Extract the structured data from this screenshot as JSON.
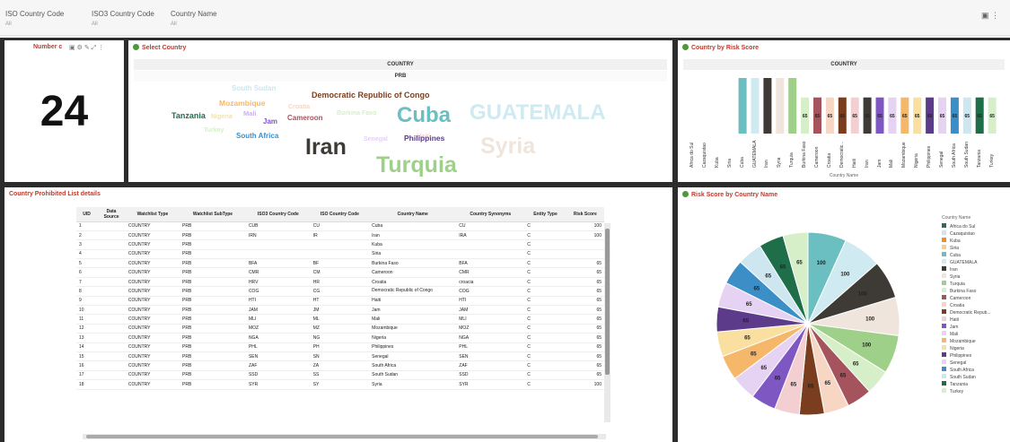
{
  "filters": [
    {
      "label": "ISO Country Code",
      "value": "All"
    },
    {
      "label": "ISO3 Country Code",
      "value": "All"
    },
    {
      "label": "Country Name",
      "value": "All"
    }
  ],
  "kpi": {
    "title": "Number c",
    "value": "24"
  },
  "wordcloud": {
    "title": "Select Country",
    "header1": "COUNTRY",
    "header2": "PRB",
    "words": [
      {
        "text": "South Sudan",
        "color": "#cde6f0"
      },
      {
        "text": "Democratic Republic of Congo",
        "color": "#7a3e1e"
      },
      {
        "text": "Mozambique",
        "color": "#f5b76a"
      },
      {
        "text": "Croatia",
        "color": "#f7d6c4"
      },
      {
        "text": "Tanzania",
        "color": "#1f6e4a"
      },
      {
        "text": "Nigeria",
        "color": "#f9dfa0"
      },
      {
        "text": "Mali",
        "color": "#c9b3e8"
      },
      {
        "text": "Jam",
        "color": "#7e57c2"
      },
      {
        "text": "Cameroon",
        "color": "#a5535d"
      },
      {
        "text": "Burkina Faso",
        "color": "#d6efc8"
      },
      {
        "text": "Cuba",
        "color": "#6bbfc0"
      },
      {
        "text": "GUATEMALA",
        "color": "#cfeaf0"
      },
      {
        "text": "Turkey",
        "color": "#d6efc8"
      },
      {
        "text": "South Africa",
        "color": "#3b8ec6"
      },
      {
        "text": "Haiti",
        "color": "#f3cfd2"
      },
      {
        "text": "Iran",
        "color": "#3e3a36"
      },
      {
        "text": "Senegal",
        "color": "#e6d2f2"
      },
      {
        "text": "Philippines",
        "color": "#5c3c8a"
      },
      {
        "text": "Syria",
        "color": "#efe5dc"
      },
      {
        "text": "Turquia",
        "color": "#9fd08a"
      }
    ]
  },
  "barchart": {
    "title": "Country by Risk Score",
    "header": "COUNTRY",
    "xlabel": "Country Name"
  },
  "table": {
    "title": "Country Prohibited List details",
    "columns": [
      "UID",
      "Data Source",
      "Watchlist Type",
      "Watchlist SubType",
      "ISO3 Country Code",
      "ISO Country Code",
      "Country Name",
      "Country Synonyms",
      "Entity Type",
      "Risk Score"
    ],
    "rows": [
      [
        "1",
        "",
        "COUNTRY",
        "PRB",
        "CUB",
        "CU",
        "Cuba",
        "CU",
        "C",
        "100"
      ],
      [
        "2",
        "",
        "COUNTRY",
        "PRB",
        "IRN",
        "IR",
        "Iran",
        "IRA",
        "C",
        "100"
      ],
      [
        "3",
        "",
        "COUNTRY",
        "PRB",
        "",
        "",
        "Kuba",
        "",
        "C",
        ""
      ],
      [
        "4",
        "",
        "COUNTRY",
        "PRB",
        "",
        "",
        "Siria",
        "",
        "C",
        ""
      ],
      [
        "5",
        "",
        "COUNTRY",
        "PRB",
        "BFA",
        "BF",
        "Burkina Faso",
        "BFA",
        "C",
        "65"
      ],
      [
        "6",
        "",
        "COUNTRY",
        "PRB",
        "CMR",
        "CM",
        "Cameroon",
        "CMR",
        "C",
        "65"
      ],
      [
        "7",
        "",
        "COUNTRY",
        "PRB",
        "HRV",
        "HR",
        "Croatia",
        "croacia",
        "C",
        "65"
      ],
      [
        "8",
        "",
        "COUNTRY",
        "PRB",
        "COG",
        "CG",
        "Democratic Republic of Congo",
        "COG",
        "C",
        "65"
      ],
      [
        "9",
        "",
        "COUNTRY",
        "PRB",
        "HTI",
        "HT",
        "Haiti",
        "HTI",
        "C",
        "65"
      ],
      [
        "10",
        "",
        "COUNTRY",
        "PRB",
        "JAM",
        "JM",
        "Jam",
        "JAM",
        "C",
        "65"
      ],
      [
        "11",
        "",
        "COUNTRY",
        "PRB",
        "MLI",
        "ML",
        "Mali",
        "MLI",
        "C",
        "65"
      ],
      [
        "12",
        "",
        "COUNTRY",
        "PRB",
        "MOZ",
        "MZ",
        "Mozambique",
        "MOZ",
        "C",
        "65"
      ],
      [
        "13",
        "",
        "COUNTRY",
        "PRB",
        "NGA",
        "NG",
        "Nigeria",
        "NGA",
        "C",
        "65"
      ],
      [
        "14",
        "",
        "COUNTRY",
        "PRB",
        "PHL",
        "PH",
        "Philippines",
        "PHL",
        "C",
        "65"
      ],
      [
        "15",
        "",
        "COUNTRY",
        "PRB",
        "SEN",
        "SN",
        "Senegal",
        "SEN",
        "C",
        "65"
      ],
      [
        "16",
        "",
        "COUNTRY",
        "PRB",
        "ZAF",
        "ZA",
        "South Africa",
        "ZAF",
        "C",
        "65"
      ],
      [
        "17",
        "",
        "COUNTRY",
        "PRB",
        "SSD",
        "SS",
        "South Sudan",
        "SSD",
        "C",
        "65"
      ],
      [
        "18",
        "",
        "COUNTRY",
        "PRB",
        "SYR",
        "SY",
        "Syria",
        "SYR",
        "C",
        "100"
      ]
    ]
  },
  "pie_title": "Risk Score by Country Name",
  "pie_legend_title": "Country Name",
  "chart_data": [
    {
      "type": "bar",
      "categories": [
        "Africa do Sul",
        "Cazaquistao",
        "Kuba",
        "Siria",
        "Cuba",
        "GUATEMALA",
        "Iran",
        "Syria",
        "Turquia",
        "Burkina Faso",
        "Cameroon",
        "Croatia",
        "Democratic...",
        "Haiti",
        "Iran",
        "Jam",
        "Mali",
        "Mozambique",
        "Nigeria",
        "Philippines",
        "Senegal",
        "South Africa",
        "South Sudan",
        "Tanzania",
        "Turkey"
      ],
      "values": [
        null,
        null,
        null,
        null,
        100,
        100,
        100,
        100,
        100,
        65,
        65,
        65,
        65,
        65,
        65,
        65,
        65,
        65,
        65,
        65,
        65,
        65,
        65,
        65,
        65
      ],
      "data_labels": [
        "",
        "",
        "",
        "",
        "",
        "",
        "",
        "",
        "",
        "65",
        "65",
        "65",
        "65",
        "65",
        "65",
        "65",
        "65",
        "65",
        "65",
        "65",
        "65",
        "65",
        "65",
        "65",
        "65"
      ],
      "colors": [
        "#2e6b5e",
        "#cde6f0",
        "#f28c28",
        "#f6d37a",
        "#6bbfc0",
        "#cfeaf0",
        "#3e3a36",
        "#efe5dc",
        "#9fd08a",
        "#d6efc8",
        "#a5535d",
        "#f7d6c4",
        "#7a3e1e",
        "#f3cfd2",
        "#3e3a36",
        "#7e57c2",
        "#e6d2f2",
        "#f5b76a",
        "#f9dfa0",
        "#5c3c8a",
        "#e6d2f2",
        "#3b8ec6",
        "#cde6f0",
        "#1f6e4a",
        "#d6efc8"
      ],
      "xlabel": "Country Name",
      "ylim": [
        0,
        100
      ]
    },
    {
      "type": "pie",
      "categories": [
        "Cuba",
        "GUATEMALA",
        "Iran",
        "Syria",
        "Turquia",
        "Burkina Faso",
        "Cameroon",
        "Croatia",
        "Democratic Repub...",
        "Haiti",
        "Jam",
        "Mali",
        "Mozambique",
        "Nigeria",
        "Philippines",
        "Senegal",
        "South Africa",
        "South Sudan",
        "Tanzania",
        "Turkey"
      ],
      "values": [
        100,
        100,
        100,
        100,
        100,
        65,
        65,
        65,
        65,
        65,
        65,
        65,
        65,
        65,
        65,
        65,
        65,
        65,
        65,
        65
      ],
      "colors": [
        "#6bbfc0",
        "#cfeaf0",
        "#3e3a36",
        "#efe5dc",
        "#9fd08a",
        "#d6efc8",
        "#a5535d",
        "#f7d6c4",
        "#7a3e1e",
        "#f3cfd2",
        "#7e57c2",
        "#e6d2f2",
        "#f5b76a",
        "#f9dfa0",
        "#5c3c8a",
        "#e6d2f2",
        "#3b8ec6",
        "#cde6f0",
        "#1f6e4a",
        "#d6efc8"
      ],
      "legend": [
        {
          "label": "Africa do Sul",
          "color": "#2e6b5e"
        },
        {
          "label": "Cazaquistao",
          "color": "#cde6f0"
        },
        {
          "label": "Kuba",
          "color": "#f28c28"
        },
        {
          "label": "Siria",
          "color": "#f6d37a"
        },
        {
          "label": "Cuba",
          "color": "#6bbfc0"
        },
        {
          "label": "GUATEMALA",
          "color": "#cfeaf0"
        },
        {
          "label": "Iran",
          "color": "#3e3a36"
        },
        {
          "label": "Syria",
          "color": "#efe5dc"
        },
        {
          "label": "Turquia",
          "color": "#9fd08a"
        },
        {
          "label": "Burkina Faso",
          "color": "#d6efc8"
        },
        {
          "label": "Cameroon",
          "color": "#a5535d"
        },
        {
          "label": "Croatia",
          "color": "#f7d6c4"
        },
        {
          "label": "Democratic Repub...",
          "color": "#7a3e1e"
        },
        {
          "label": "Haiti",
          "color": "#f3cfd2"
        },
        {
          "label": "Jam",
          "color": "#7e57c2"
        },
        {
          "label": "Mali",
          "color": "#e6d2f2"
        },
        {
          "label": "Mozambique",
          "color": "#f5b76a"
        },
        {
          "label": "Nigeria",
          "color": "#f9dfa0"
        },
        {
          "label": "Philippines",
          "color": "#5c3c8a"
        },
        {
          "label": "Senegal",
          "color": "#e6d2f2"
        },
        {
          "label": "South Africa",
          "color": "#3b8ec6"
        },
        {
          "label": "South Sudan",
          "color": "#cde6f0"
        },
        {
          "label": "Tanzania",
          "color": "#1f6e4a"
        },
        {
          "label": "Turkey",
          "color": "#d6efc8"
        }
      ]
    }
  ]
}
